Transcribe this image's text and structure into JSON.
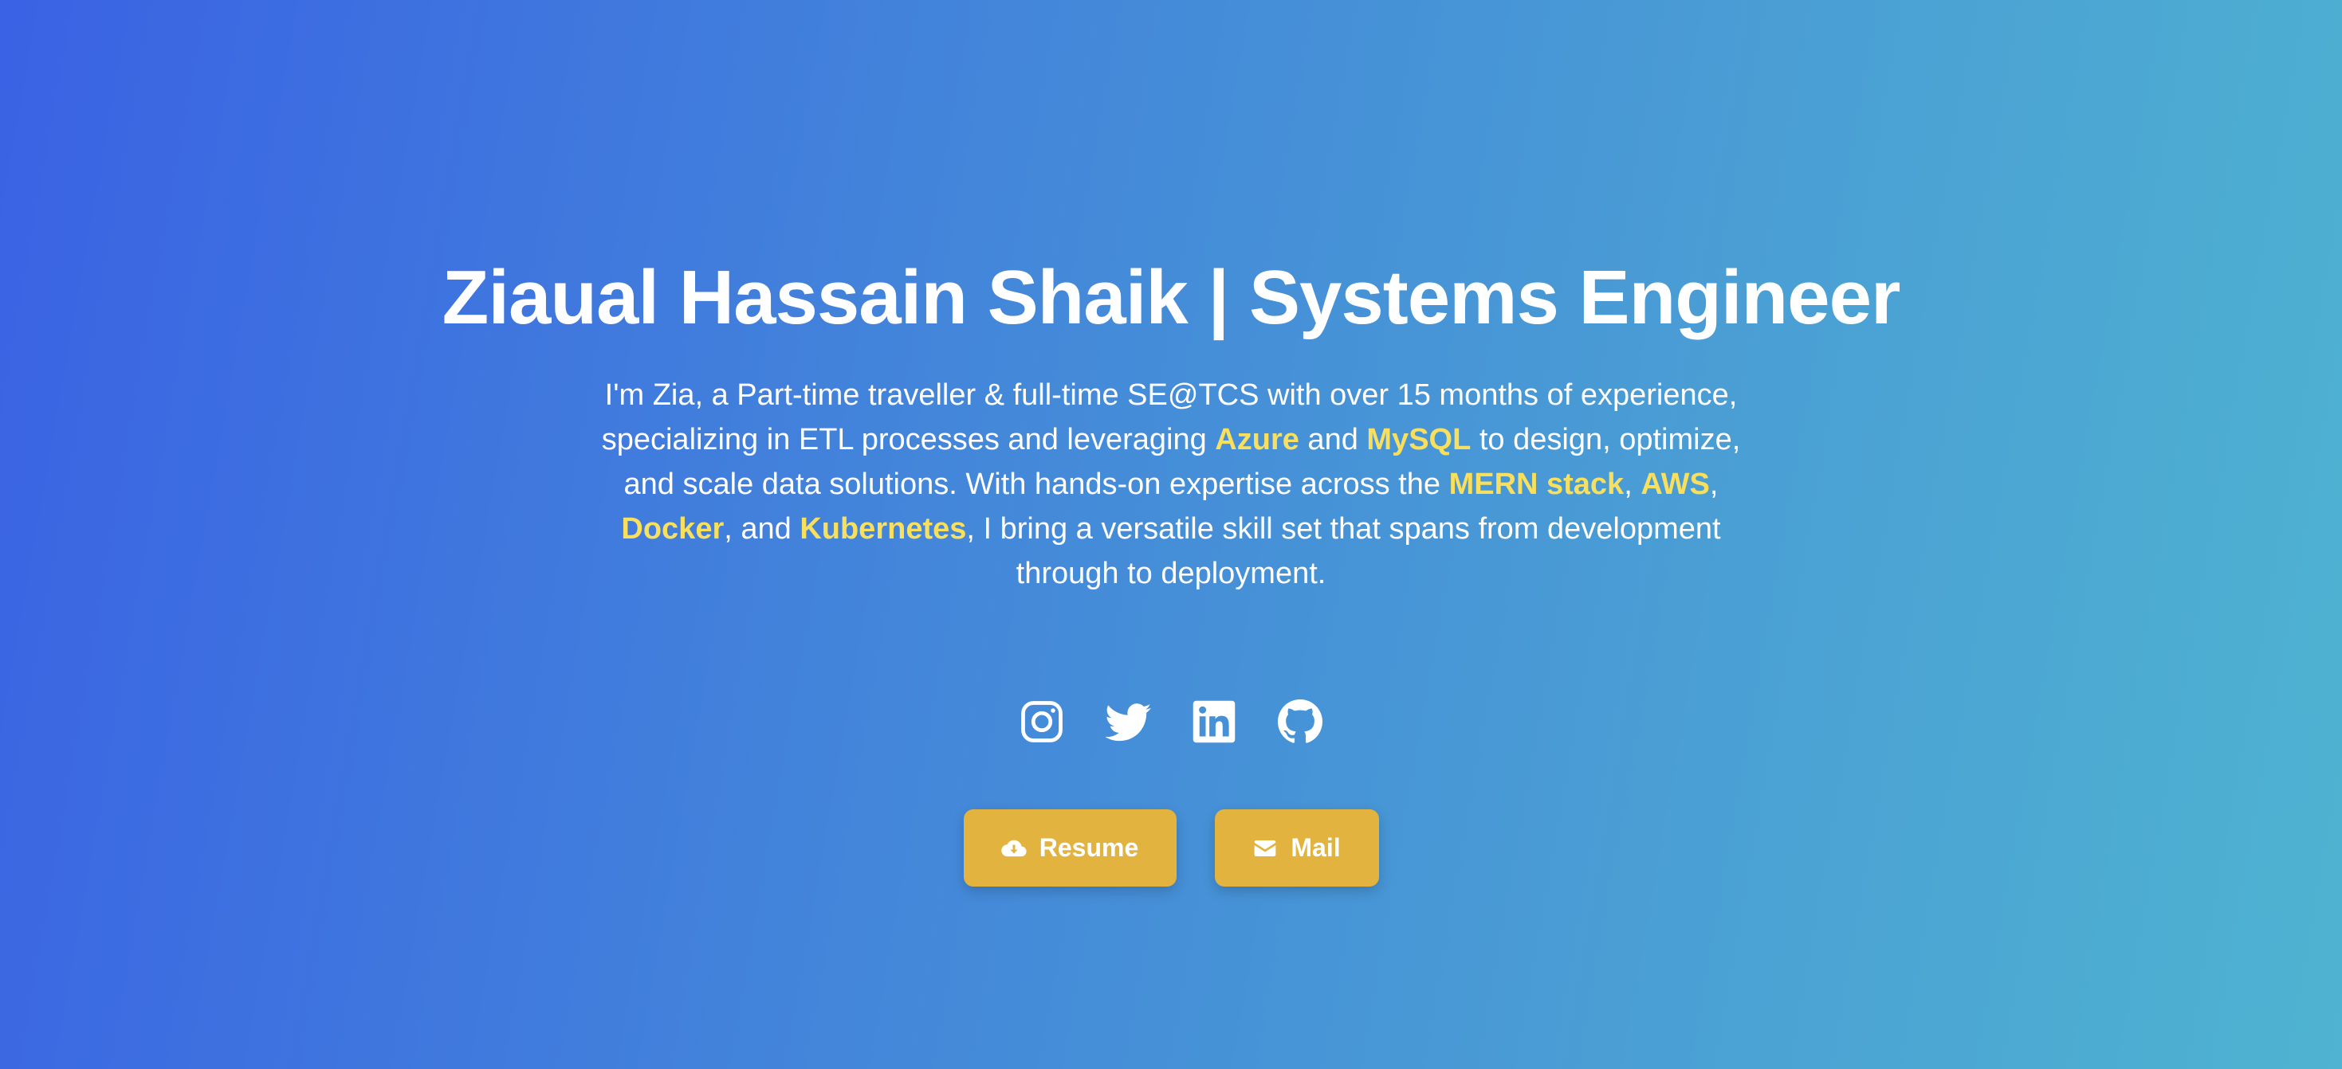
{
  "hero": {
    "title": "Ziaual Hassain Shaik | Systems Engineer",
    "description": {
      "part1": "I'm Zia, a Part-time traveller & full-time SE@TCS with over 15 months of experience, specializing in ETL processes and leveraging ",
      "azure": "Azure",
      "part2": " and ",
      "mysql": "MySQL",
      "part3": " to design, optimize, and scale data solutions. With hands-on expertise across the ",
      "mern": "MERN stack",
      "part4": ", ",
      "aws": "AWS",
      "part5": ", ",
      "docker": "Docker",
      "part6": ", and ",
      "kubernetes": "Kubernetes",
      "part7": ", I bring a versatile skill set that spans from development through to deployment."
    }
  },
  "social": [
    {
      "icon": "instagram-icon"
    },
    {
      "icon": "twitter-icon"
    },
    {
      "icon": "linkedin-icon"
    },
    {
      "icon": "github-icon"
    }
  ],
  "actions": {
    "resume_label": "Resume",
    "resume_icon": "cloud-download-icon",
    "mail_label": "Mail",
    "mail_icon": "envelope-icon"
  },
  "colors": {
    "gradient_start": "#3a62e4",
    "gradient_end": "#4fb3d1",
    "highlight": "#f8df5e",
    "button": "#e2b43f",
    "text": "#ffffff"
  }
}
